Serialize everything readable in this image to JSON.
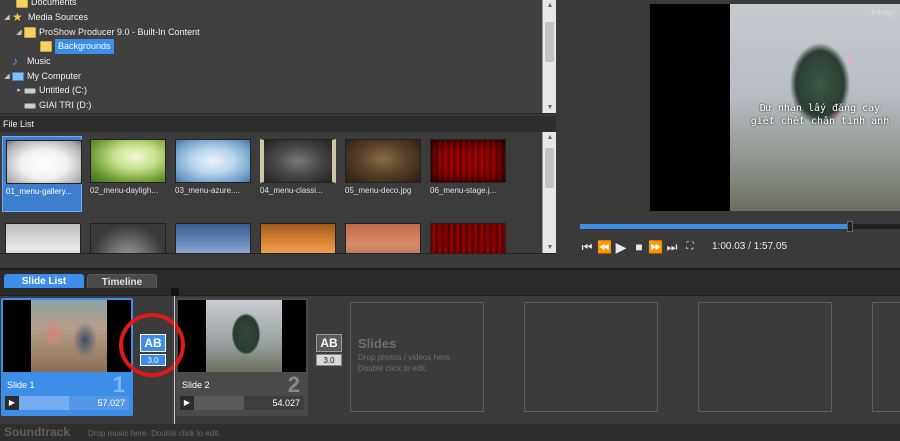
{
  "folder_tree": {
    "items": [
      {
        "label": "Documents",
        "icon": "folder-icon"
      },
      {
        "label": "Media Sources",
        "icon": "star-icon"
      },
      {
        "label": "ProShow Producer 9.0 - Built-In Content",
        "icon": "folder-icon"
      },
      {
        "label": "Backgrounds",
        "icon": "folder-icon",
        "selected": true
      },
      {
        "label": "Music",
        "icon": "music-note-icon"
      },
      {
        "label": "My Computer",
        "icon": "computer-icon"
      },
      {
        "label": "Untitled (C:)",
        "icon": "drive-icon"
      },
      {
        "label": "GIAI TRI (D:)",
        "icon": "drive-icon"
      }
    ]
  },
  "file_list": {
    "title": "File List",
    "files": [
      {
        "name": "01_menu-gallery...",
        "selected": true
      },
      {
        "name": "02_menu-dayligh..."
      },
      {
        "name": "03_menu-azure...."
      },
      {
        "name": "04_menu-classi..."
      },
      {
        "name": "05_menu-deco.jpg"
      },
      {
        "name": "06_menu-stage.j..."
      }
    ]
  },
  "preview": {
    "watermark": "# insta_",
    "caption_line1": "Dự nhận lấy đắng cay",
    "caption_line2": "giết chết chân tình anh",
    "timecode": "1:00.03 / 1:57.05",
    "progress": 0.843,
    "controls": [
      "skip-to-start-icon",
      "rewind-icon",
      "play-icon",
      "stop-icon",
      "fast-forward-icon",
      "skip-to-end-icon",
      "fullscreen-icon"
    ]
  },
  "tabs": {
    "slide_list": "Slide List",
    "timeline": "Timeline"
  },
  "slides": [
    {
      "name": "Slide 1",
      "number": "1",
      "duration": "57.027",
      "selected": true
    },
    {
      "name": "Slide 2",
      "number": "2",
      "duration": "54.027"
    }
  ],
  "transitions": [
    {
      "label": "AB",
      "value": "3.0",
      "selected": true
    },
    {
      "label": "AB",
      "value": "3.0"
    }
  ],
  "placeholder": {
    "title": "Slides",
    "line1": "Drop photos / videos here.",
    "line2": "Double click to edit."
  },
  "soundtrack": {
    "title": "Soundtrack",
    "hint": "Drop music here.  Double click to edit."
  },
  "colors": {
    "accent": "#3d8ee8",
    "highlight_circle": "#e01818"
  }
}
